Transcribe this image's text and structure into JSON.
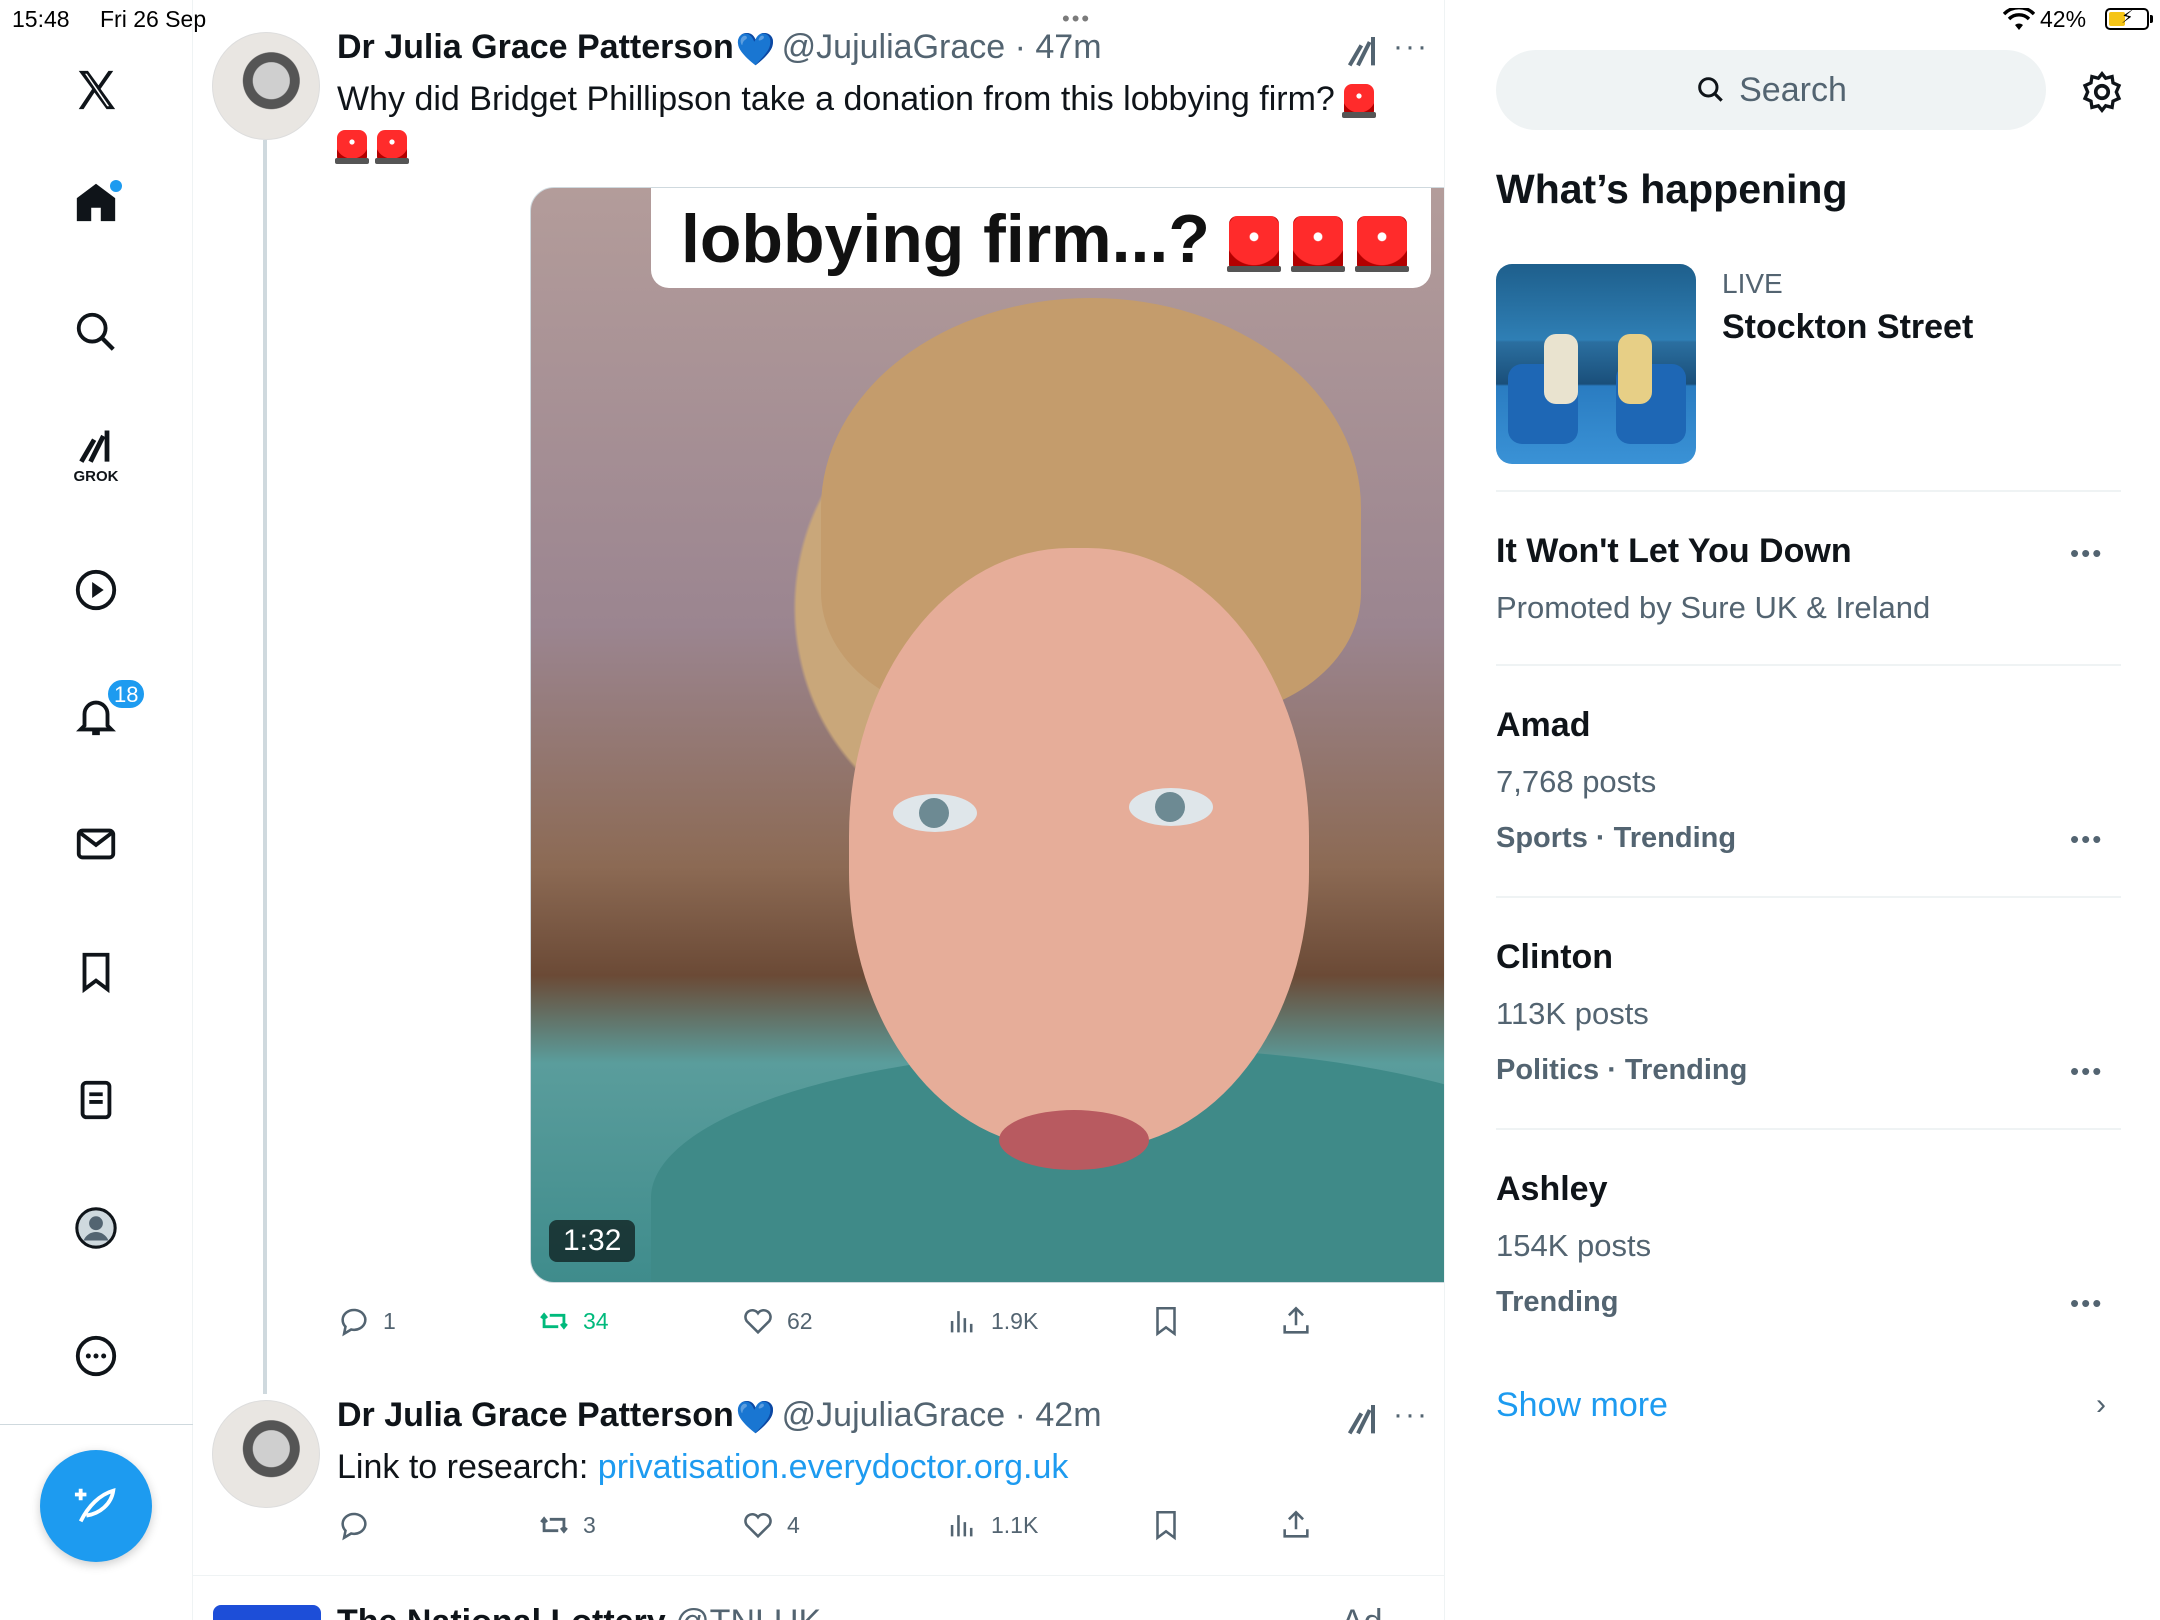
{
  "status_bar": {
    "time": "15:48",
    "date": "Fri 26 Sep",
    "battery": "42%"
  },
  "nav": {
    "grok_label": "GROK",
    "notifications_badge": "18"
  },
  "tweets": [
    {
      "name": "Dr Julia Grace Patterson",
      "handle": "@JujuliaGrace",
      "time": "· 47m",
      "text": "Why did Bridget Phillipson take a donation from this lobbying firm?",
      "video": {
        "caption": "lobbying firm...?",
        "duration": "1:32"
      },
      "stats": {
        "replies": "1",
        "reposts": "34",
        "likes": "62",
        "views": "1.9K"
      }
    },
    {
      "name": "Dr Julia Grace Patterson",
      "handle": "@JujuliaGrace",
      "time": "· 42m",
      "text_prefix": "Link to research: ",
      "link": "privatisation.everydoctor.org.uk",
      "stats": {
        "replies": "",
        "reposts": "3",
        "likes": "4",
        "views": "1.1K"
      }
    }
  ],
  "ad_peek": {
    "name": "The National Lottery",
    "handle": "@TNLUK",
    "label": "Ad"
  },
  "search": {
    "placeholder": "Search"
  },
  "whats_happening": {
    "title": "What’s happening",
    "live": {
      "label": "LIVE",
      "title": "Stockton Street"
    },
    "trends": [
      {
        "title": "It Won't Let You Down",
        "sub": "Promoted by Sure UK & Ireland",
        "cat": ""
      },
      {
        "title": "Amad",
        "sub": "7,768 posts",
        "cat": "Sports · Trending"
      },
      {
        "title": "Clinton",
        "sub": "113K posts",
        "cat": "Politics · Trending"
      },
      {
        "title": "Ashley",
        "sub": "154K posts",
        "cat": "Trending"
      }
    ],
    "show_more": "Show more"
  },
  "colors": {
    "accent": "#1d9bf0",
    "repost_active": "#00ba7c",
    "secondary_text": "#536471"
  }
}
